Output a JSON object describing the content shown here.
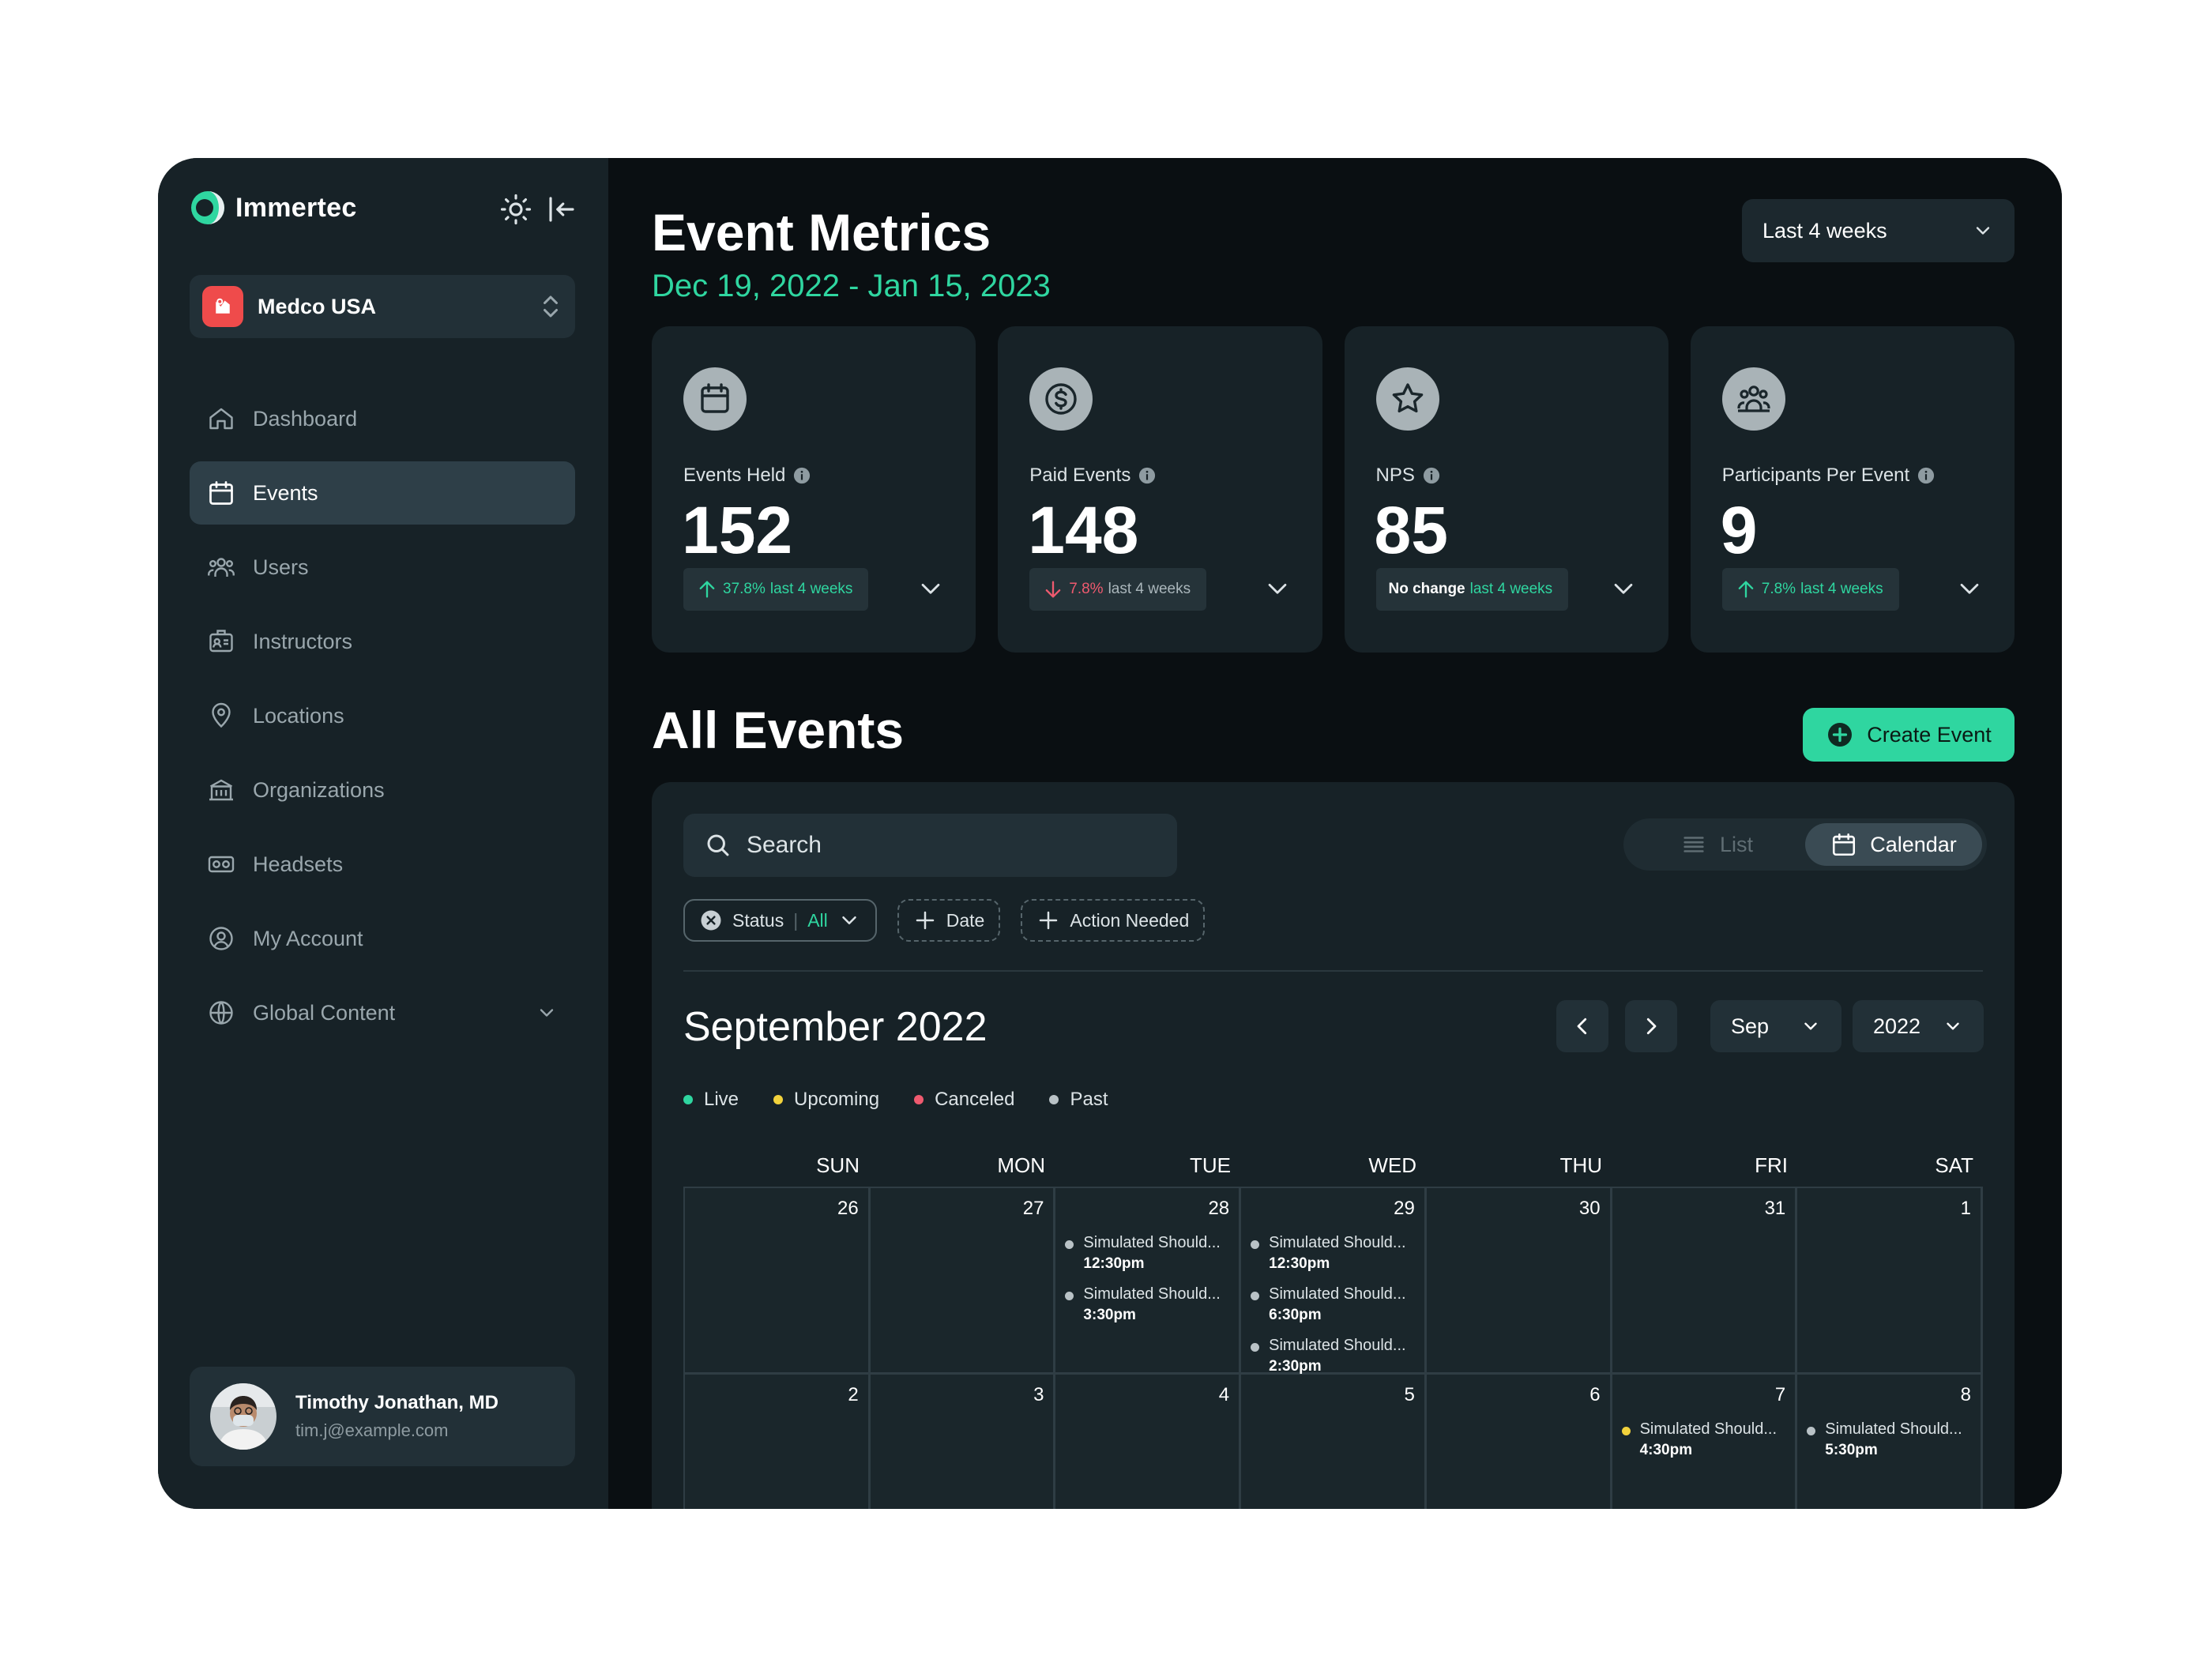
{
  "brand": {
    "name": "Immertec"
  },
  "org": {
    "name": "Medco USA"
  },
  "nav": [
    {
      "label": "Dashboard",
      "icon": "home-icon",
      "active": false
    },
    {
      "label": "Events",
      "icon": "calendar-icon",
      "active": true
    },
    {
      "label": "Users",
      "icon": "users-icon",
      "active": false
    },
    {
      "label": "Instructors",
      "icon": "id-card-icon",
      "active": false
    },
    {
      "label": "Locations",
      "icon": "location-pin-icon",
      "active": false
    },
    {
      "label": "Organizations",
      "icon": "building-icon",
      "active": false
    },
    {
      "label": "Headsets",
      "icon": "vr-headset-icon",
      "active": false
    },
    {
      "label": "My Account",
      "icon": "user-circle-icon",
      "active": false
    },
    {
      "label": "Global Content",
      "icon": "globe-icon",
      "active": false
    }
  ],
  "user": {
    "name": "Timothy Jonathan, MD",
    "email": "tim.j@example.com"
  },
  "header": {
    "title": "Event Metrics",
    "date_range": "Dec 19, 2022 -  Jan 15, 2023",
    "period": "Last 4 weeks"
  },
  "metrics": [
    {
      "label": "Events Held",
      "value": "152",
      "trend": "up",
      "change": "37.8%",
      "change_text": "last 4 weeks",
      "icon": "calendar-icon"
    },
    {
      "label": "Paid Events",
      "value": "148",
      "trend": "down",
      "change": "7.8%",
      "change_text": "last 4 weeks",
      "icon": "dollar-icon"
    },
    {
      "label": "NPS",
      "value": "85",
      "trend": "none",
      "change": "No change",
      "change_text": "last 4 weeks",
      "icon": "star-icon"
    },
    {
      "label": "Participants Per Event",
      "value": "9",
      "trend": "up",
      "change": "7.8%",
      "change_text": "last 4 weeks",
      "icon": "group-icon"
    }
  ],
  "events": {
    "title": "All Events",
    "create_label": "Create Event",
    "search_placeholder": "Search",
    "views": {
      "list": "List",
      "calendar": "Calendar",
      "active": "Calendar"
    },
    "filters": {
      "status_label": "Status",
      "status_value": "All",
      "date_label": "Date",
      "action_label": "Action Needed"
    }
  },
  "calendar": {
    "month_title": "September 2022",
    "month_select": "Sep",
    "year_select": "2022",
    "legend": [
      {
        "label": "Live",
        "color": "#2fd6a0"
      },
      {
        "label": "Upcoming",
        "color": "#f2d23c"
      },
      {
        "label": "Canceled",
        "color": "#ef5a6f"
      },
      {
        "label": "Past",
        "color": "#b9c2c6"
      }
    ],
    "weekdays": [
      "SUN",
      "MON",
      "TUE",
      "WED",
      "THU",
      "FRI",
      "SAT"
    ],
    "weeks": [
      [
        {
          "day": "26",
          "events": []
        },
        {
          "day": "27",
          "events": []
        },
        {
          "day": "28",
          "events": [
            {
              "title": "Simulated Should...",
              "time": "12:30pm",
              "status": "past"
            },
            {
              "title": "Simulated Should...",
              "time": "3:30pm",
              "status": "past"
            }
          ]
        },
        {
          "day": "29",
          "events": [
            {
              "title": "Simulated Should...",
              "time": "12:30pm",
              "status": "past"
            },
            {
              "title": "Simulated Should...",
              "time": "6:30pm",
              "status": "past"
            },
            {
              "title": "Simulated Should...",
              "time": "2:30pm",
              "status": "past"
            }
          ]
        },
        {
          "day": "30",
          "events": []
        },
        {
          "day": "31",
          "events": []
        },
        {
          "day": "1",
          "events": []
        }
      ],
      [
        {
          "day": "2",
          "events": []
        },
        {
          "day": "3",
          "events": []
        },
        {
          "day": "4",
          "events": []
        },
        {
          "day": "5",
          "events": []
        },
        {
          "day": "6",
          "events": []
        },
        {
          "day": "7",
          "events": [
            {
              "title": "Simulated Should...",
              "time": "4:30pm",
              "status": "upcoming"
            }
          ]
        },
        {
          "day": "8",
          "events": [
            {
              "title": "Simulated Should...",
              "time": "5:30pm",
              "status": "past"
            }
          ]
        }
      ]
    ]
  },
  "colors": {
    "accent": "#2fd6a0",
    "sidebar_bg": "#172227",
    "main_bg": "#0a0f12",
    "danger": "#ef5a6f",
    "org_logo": "#ef4b4b"
  }
}
